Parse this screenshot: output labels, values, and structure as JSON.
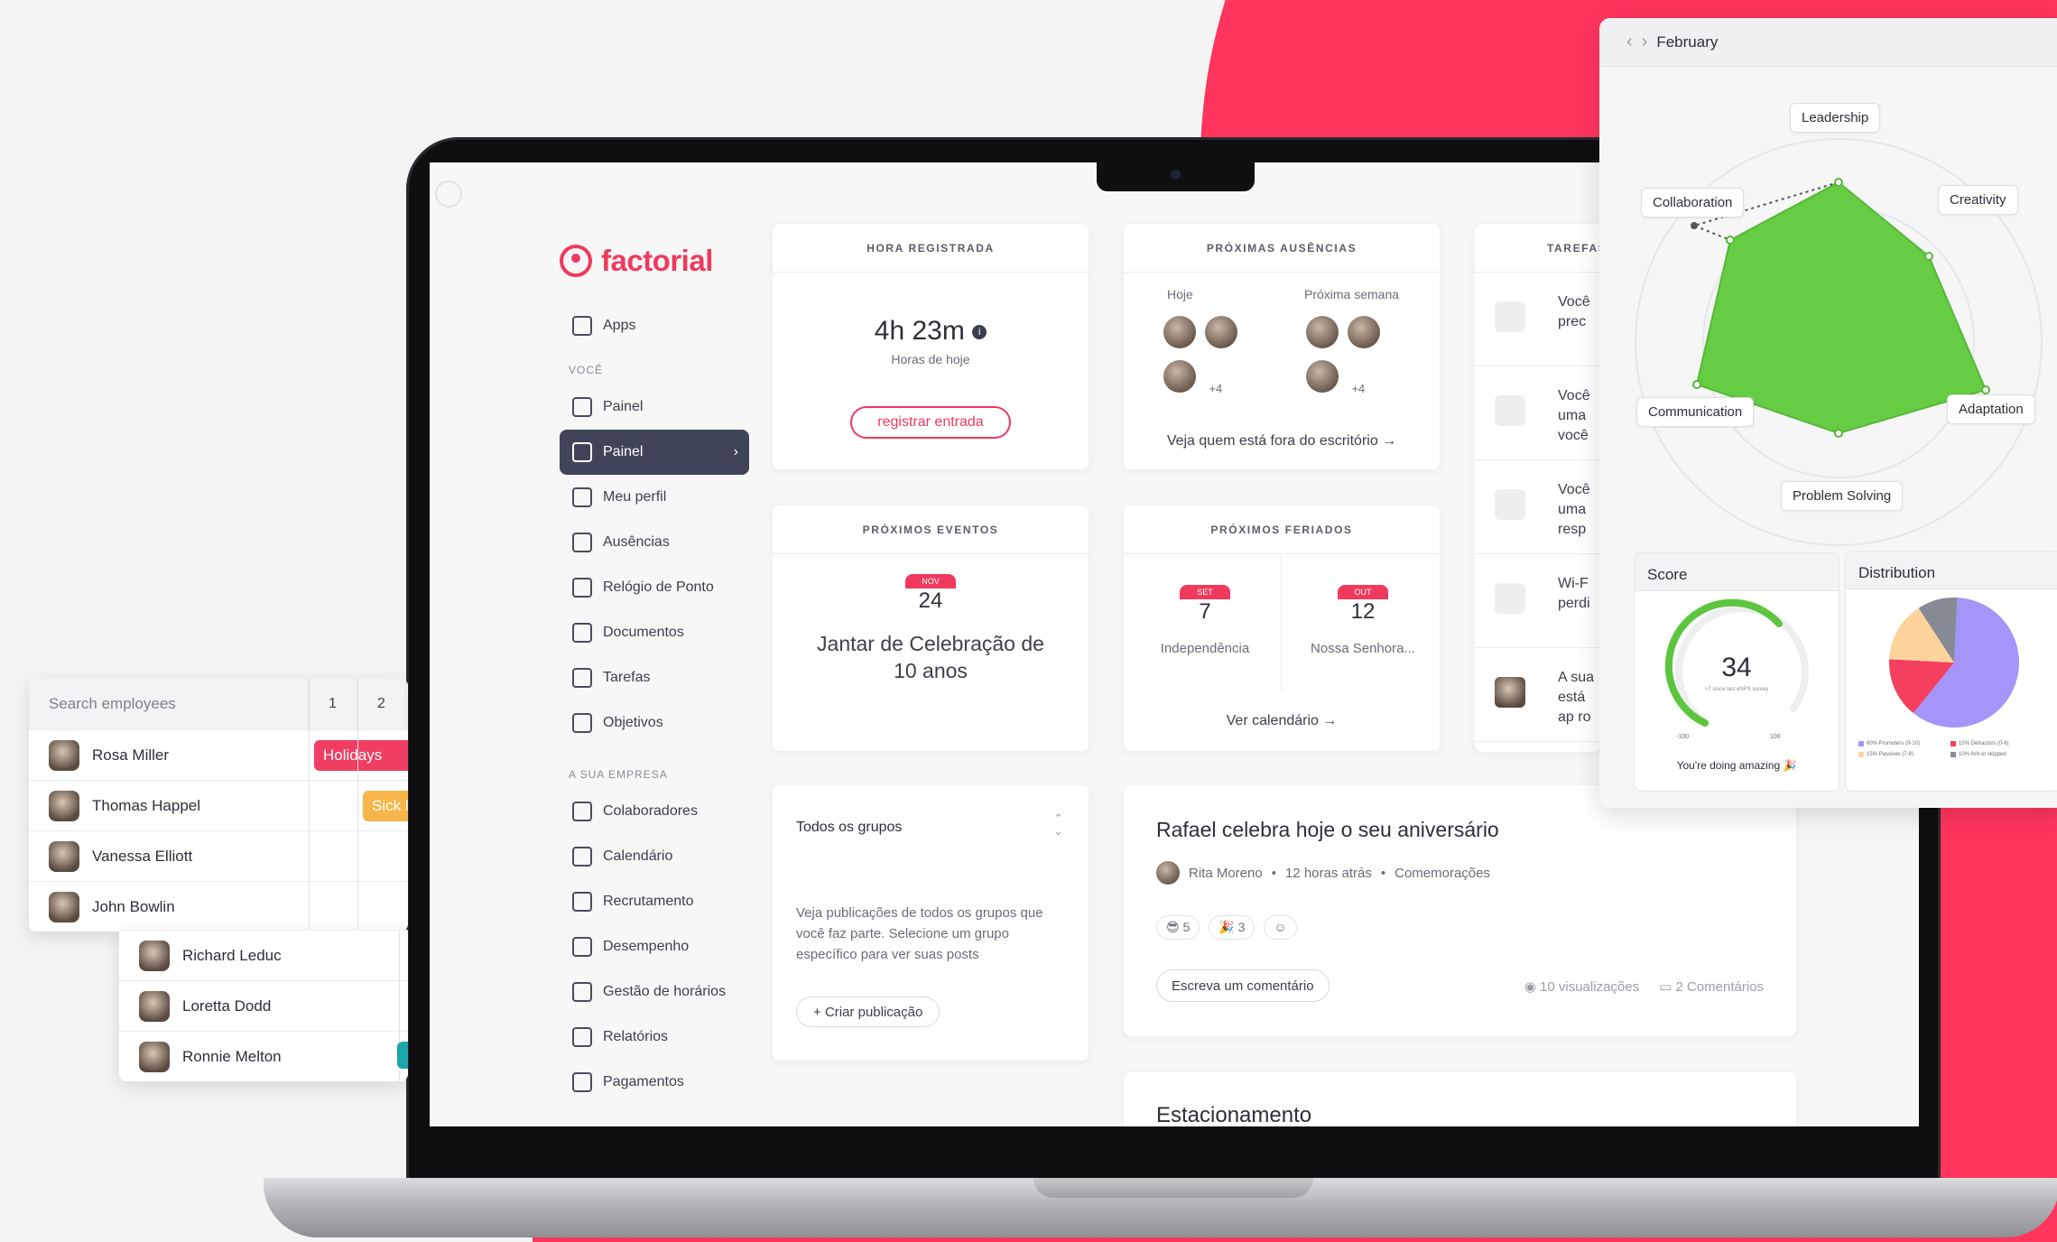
{
  "colors": {
    "brand": "#ef3a5d",
    "accent_bg": "#ff355e",
    "radar_fill": "#66cc44",
    "dark_nav": "#404458"
  },
  "app": {
    "name": "factorial"
  },
  "sidebar": {
    "top_item": "Apps",
    "section_you": "VOCÊ",
    "you_items": [
      {
        "label": "Painel",
        "icon": "home-icon"
      },
      {
        "label": "Painel",
        "icon": "home-icon",
        "active": true
      },
      {
        "label": "Meu perfil",
        "icon": "profile-icon"
      },
      {
        "label": "Ausências",
        "icon": "absence-icon"
      },
      {
        "label": "Relógio de Ponto",
        "icon": "clock-icon"
      },
      {
        "label": "Documentos",
        "icon": "folder-icon"
      },
      {
        "label": "Tarefas",
        "icon": "check-icon"
      },
      {
        "label": "Objetivos",
        "icon": "flag-icon"
      }
    ],
    "section_company": "A SUA EMPRESA",
    "company_items": [
      {
        "label": "Colaboradores",
        "icon": "people-icon"
      },
      {
        "label": "Calendário",
        "icon": "calendar-icon"
      },
      {
        "label": "Recrutamento",
        "icon": "search-user-icon"
      },
      {
        "label": "Desempenho",
        "icon": "performance-icon"
      },
      {
        "label": "Gestão de horários",
        "icon": "schedule-icon"
      },
      {
        "label": "Relatórios",
        "icon": "report-icon"
      },
      {
        "label": "Pagamentos",
        "icon": "payment-icon"
      }
    ]
  },
  "cards": {
    "hours": {
      "title": "HORA REGISTRADA",
      "value": "4h 23m",
      "sub": "Horas de hoje",
      "button": "registrar entrada"
    },
    "absences": {
      "title": "PRÓXIMAS AUSÊNCIAS",
      "col1": "Hoje",
      "col2": "Próxima semana",
      "more1": "+4",
      "more2": "+4",
      "link": "Veja quem está fora do escritório"
    },
    "tasks": {
      "title": "TAREFAS",
      "items": [
        "Você\nprec",
        "Você\numa\nvocê",
        "Você\numa\nresp",
        "Wi-F\nperdi",
        "A sua\nestá\nap ro"
      ]
    },
    "events": {
      "title": "PRÓXIMOS EVENTOS",
      "month": "NOV",
      "day": "24",
      "name": "Jantar de Celebração de 10 anos"
    },
    "holidays": {
      "title": "PRÓXIMOS FERIADOS",
      "h1_month": "SET",
      "h1_day": "7",
      "h1_name": "Independência",
      "h2_month": "OUT",
      "h2_day": "12",
      "h2_name": "Nossa Senhora...",
      "link": "Ver calendário"
    },
    "groups": {
      "select": "Todos os grupos",
      "text": "Veja publicações de todos os grupos que você faz parte. Selecione um grupo específico para ver suas posts",
      "button": "Criar publicação"
    },
    "post": {
      "title": "Rafael celebra hoje o seu aniversário",
      "author": "Rita Moreno",
      "time": "12 horas atrás",
      "category": "Comemorações",
      "reaction1": "5",
      "reaction2": "3",
      "comment_btn": "Escreva um comentário",
      "views": "10 visualizações",
      "comments": "2 Comentários"
    },
    "parking": {
      "title": "Estacionamento"
    }
  },
  "radar": {
    "month": "February",
    "labels": [
      "Leadership",
      "Creativity",
      "Adaptation",
      "Problem Solving",
      "Communication",
      "Collaboration"
    ],
    "score": {
      "title": "Score",
      "value": "34",
      "sub": "+7 since last eNPS survey",
      "min": "-100",
      "max": "100",
      "footer": "You're doing amazing 🎉"
    },
    "distribution": {
      "title": "Distribution",
      "legend": [
        "60% Promoters (9-10)",
        "15% Detractors (0-6)",
        "15% Passives (7-8)",
        "10% N/A or skipped"
      ],
      "values": [
        60,
        15,
        15,
        10
      ],
      "colors": [
        "#a594f9",
        "#f43f5e",
        "#fcd39b",
        "#858a94"
      ]
    }
  },
  "employees": {
    "search_placeholder": "Search employees",
    "cols": [
      "1",
      "2"
    ],
    "rows": [
      {
        "name": "Rosa Miller",
        "tag": "Holidays",
        "tag_color": "#f03e63"
      },
      {
        "name": "Thomas Happel",
        "tag": "Sick l",
        "tag_color": "#f6b64a"
      },
      {
        "name": "Vanessa Elliott"
      },
      {
        "name": "John Bowlin"
      }
    ],
    "rows2": [
      {
        "name": "Richard Leduc"
      },
      {
        "name": "Loretta Dodd"
      },
      {
        "name": "Ronnie Melton"
      }
    ]
  }
}
